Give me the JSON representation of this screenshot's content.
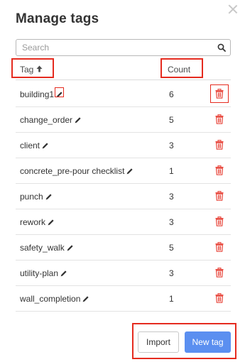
{
  "dialog": {
    "title": "Manage tags"
  },
  "search": {
    "placeholder": "Search"
  },
  "table": {
    "headers": {
      "tag": "Tag",
      "count": "Count"
    },
    "rows": [
      {
        "name": "building1",
        "count": "6"
      },
      {
        "name": "change_order",
        "count": "5"
      },
      {
        "name": "client",
        "count": "3"
      },
      {
        "name": "concrete_pre-pour checklist",
        "count": "1"
      },
      {
        "name": "punch",
        "count": "3"
      },
      {
        "name": "rework",
        "count": "3"
      },
      {
        "name": "safety_walk",
        "count": "5"
      },
      {
        "name": "utility-plan",
        "count": "3"
      },
      {
        "name": "wall_completion",
        "count": "1"
      }
    ]
  },
  "footer": {
    "import_label": "Import",
    "new_tag_label": "New tag"
  },
  "colors": {
    "accent": "#5b8ff0",
    "delete": "#e8473c",
    "highlight": "#e52b1f"
  }
}
